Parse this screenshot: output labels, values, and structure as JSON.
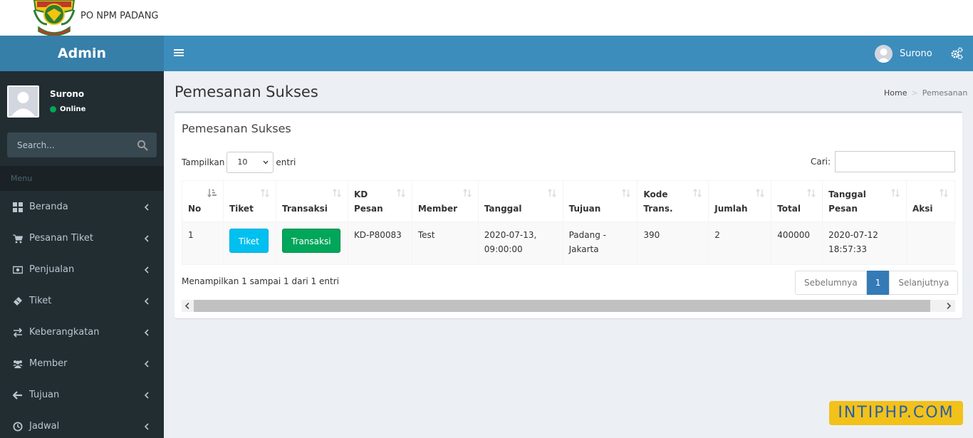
{
  "brand": {
    "text": "PO NPM PADANG",
    "logo_icon": "npm-logo"
  },
  "header": {
    "logo": "Admin",
    "user_name": "Surono"
  },
  "sidebar": {
    "user": {
      "name": "Surono",
      "status": "Online"
    },
    "search_placeholder": "Search...",
    "menu_header": "Menu",
    "items": [
      {
        "label": "Beranda",
        "icon": "dashboard-icon"
      },
      {
        "label": "Pesanan Tiket",
        "icon": "cart-icon"
      },
      {
        "label": "Penjualan",
        "icon": "money-icon"
      },
      {
        "label": "Tiket",
        "icon": "ticket-icon"
      },
      {
        "label": "Keberangkatan",
        "icon": "exchange-icon"
      },
      {
        "label": "Member",
        "icon": "users-icon"
      },
      {
        "label": "Tujuan",
        "icon": "arrow-left-icon"
      },
      {
        "label": "Jadwal",
        "icon": "clock-icon"
      }
    ]
  },
  "page": {
    "title": "Pemesanan Sukses",
    "breadcrumb": {
      "home": "Home",
      "current": "Pemesanan"
    }
  },
  "box": {
    "title": "Pemesanan Sukses",
    "length": {
      "prefix": "Tampilkan",
      "value": "10",
      "suffix": "entri"
    },
    "search_label": "Cari:",
    "columns": [
      "No",
      "Tiket",
      "Transaksi",
      "KD Pesan",
      "Member",
      "Tanggal",
      "Tujuan",
      "Kode Trans.",
      "Jumlah",
      "Total",
      "Tanggal Pesan",
      "Aksi"
    ],
    "rows": [
      {
        "no": "1",
        "tiket_button": "Tiket",
        "transaksi_button": "Transaksi",
        "kd_pesan": "KD-P80083",
        "member": "Test",
        "tanggal": "2020-07-13, 09:00:00",
        "tujuan": "Padang - Jakarta",
        "kode_trans": "390",
        "jumlah": "2",
        "total": "400000",
        "tanggal_pesan": "2020-07-12 18:57:33",
        "aksi": ""
      }
    ],
    "info": "Menampilkan 1 sampai 1 dari 1 entri",
    "pager": {
      "prev": "Sebelumnya",
      "page": "1",
      "next": "Selanjutnya"
    }
  },
  "watermark": "INTIPHP.COM",
  "colors": {
    "sidebar": "#222d32",
    "navbar": "#3c8dbc",
    "logo_bg": "#367fa9",
    "info": "#00c0ef",
    "success": "#00a65a"
  }
}
